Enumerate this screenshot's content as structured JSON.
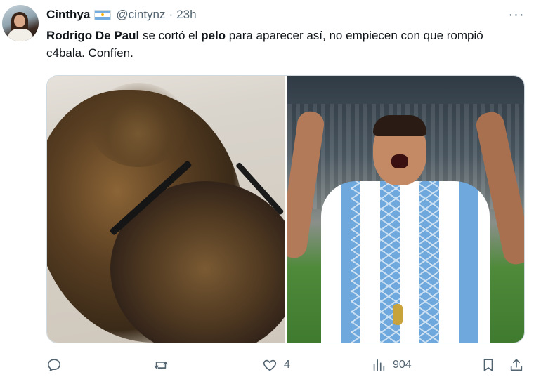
{
  "author": {
    "name": "Cinthya",
    "handle": "@cintynz",
    "separator": "·",
    "time": "23h"
  },
  "tweet": {
    "parts": {
      "p1": "Rodrigo De Paul",
      "p2": " se cortó el ",
      "p3": "pelo",
      "p4": " para aparecer así, no empiecen con que rompió c4bala. Confíen."
    }
  },
  "more_icon": "···",
  "actions": {
    "reply": {
      "icon": "reply-icon",
      "count": ""
    },
    "retweet": {
      "icon": "retweet-icon",
      "count": ""
    },
    "like": {
      "icon": "heart-icon",
      "count": "4"
    },
    "views": {
      "icon": "views-icon",
      "count": "904"
    },
    "bookmark": {
      "icon": "bookmark-icon"
    },
    "share": {
      "icon": "share-icon"
    }
  },
  "colors": {
    "text": "#0f1419",
    "secondary": "#536471",
    "border": "#cfd9de",
    "flag_blue": "#74acdf",
    "flag_sun": "#f6b40e"
  }
}
